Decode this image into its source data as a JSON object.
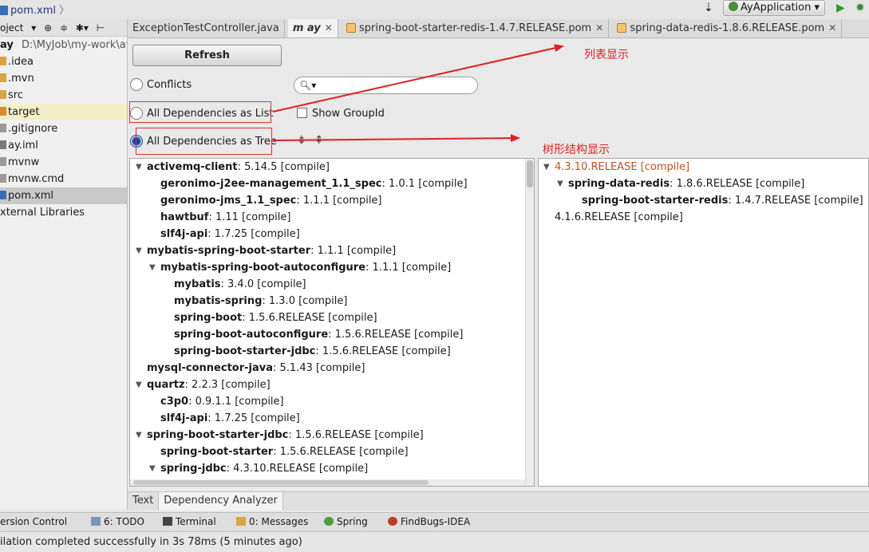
{
  "topbar": {
    "breadcrumb": "pom.xml",
    "run_config": "AyApplication"
  },
  "project": {
    "toolbar_label": "oject",
    "root_label": "ay",
    "root_path": "D:\\MyJob\\my-work\\ay",
    "items": [
      {
        "label": ".idea"
      },
      {
        "label": ".mvn"
      },
      {
        "label": "src"
      },
      {
        "label": "target"
      },
      {
        "label": ".gitignore"
      },
      {
        "label": "ay.iml"
      },
      {
        "label": "mvnw"
      },
      {
        "label": "mvnw.cmd"
      },
      {
        "label": "pom.xml"
      },
      {
        "label": "xternal Libraries"
      }
    ]
  },
  "tabs": [
    {
      "label": "ExceptionTestController.java"
    },
    {
      "label": "m ay"
    },
    {
      "label": "spring-boot-starter-redis-1.4.7.RELEASE.pom"
    },
    {
      "label": "spring-data-redis-1.8.6.RELEASE.pom"
    }
  ],
  "analyzer": {
    "refresh_label": "Refresh",
    "conflicts_label": "Conflicts",
    "as_list_label": "All Dependencies as List",
    "as_tree_label": "All Dependencies as Tree",
    "show_groupid_label": "Show GroupId",
    "search_placeholder": "",
    "selected_mode": "tree"
  },
  "left_tree": [
    {
      "name": "activemq-client",
      "version": ": 5.14.5 [compile]",
      "indent": 0,
      "expanded": true
    },
    {
      "name": "geronimo-j2ee-management_1.1_spec",
      "version": ": 1.0.1 [compile]",
      "indent": 1
    },
    {
      "name": "geronimo-jms_1.1_spec",
      "version": ": 1.1.1 [compile]",
      "indent": 1
    },
    {
      "name": "hawtbuf",
      "version": ": 1.11 [compile]",
      "indent": 1
    },
    {
      "name": "slf4j-api",
      "version": ": 1.7.25 [compile]",
      "indent": 1
    },
    {
      "name": "mybatis-spring-boot-starter",
      "version": ": 1.1.1 [compile]",
      "indent": 0,
      "expanded": true
    },
    {
      "name": "mybatis-spring-boot-autoconfigure",
      "version": ": 1.1.1 [compile]",
      "indent": 1,
      "expanded": true
    },
    {
      "name": "mybatis",
      "version": ": 3.4.0 [compile]",
      "indent": 2
    },
    {
      "name": "mybatis-spring",
      "version": ": 1.3.0 [compile]",
      "indent": 2
    },
    {
      "name": "spring-boot",
      "version": ": 1.5.6.RELEASE [compile]",
      "indent": 2
    },
    {
      "name": "spring-boot-autoconfigure",
      "version": ": 1.5.6.RELEASE [compile]",
      "indent": 2
    },
    {
      "name": "spring-boot-starter-jdbc",
      "version": ": 1.5.6.RELEASE [compile]",
      "indent": 2
    },
    {
      "name": "mysql-connector-java",
      "version": ": 5.1.43 [compile]",
      "indent": 0
    },
    {
      "name": "quartz",
      "version": ": 2.2.3 [compile]",
      "indent": 0,
      "expanded": true
    },
    {
      "name": "c3p0",
      "version": ": 0.9.1.1 [compile]",
      "indent": 1
    },
    {
      "name": "slf4j-api",
      "version": ": 1.7.25 [compile]",
      "indent": 1
    },
    {
      "name": "spring-boot-starter-jdbc",
      "version": ": 1.5.6.RELEASE [compile]",
      "indent": 0,
      "expanded": true
    },
    {
      "name": "spring-boot-starter",
      "version": ": 1.5.6.RELEASE [compile]",
      "indent": 1
    },
    {
      "name": "spring-jdbc",
      "version": ": 4.3.10.RELEASE [compile]",
      "indent": 1,
      "expanded": true
    }
  ],
  "right_tree": [
    {
      "name": "",
      "version": "4.3.10.RELEASE [compile]",
      "indent": 0,
      "expanded": true,
      "orange": true
    },
    {
      "name": "spring-data-redis",
      "version": ": 1.8.6.RELEASE [compile]",
      "indent": 1,
      "expanded": true
    },
    {
      "name": "spring-boot-starter-redis",
      "version": ": 1.4.7.RELEASE [compile]",
      "indent": 2
    },
    {
      "name": "",
      "version": "4.1.6.RELEASE [compile]",
      "indent": 0
    }
  ],
  "bottom_tabs": [
    {
      "label": "Text"
    },
    {
      "label": "Dependency Analyzer"
    }
  ],
  "tool_windows": [
    {
      "label": "ersion Control"
    },
    {
      "label": "6: TODO"
    },
    {
      "label": "Terminal"
    },
    {
      "label": "0: Messages"
    },
    {
      "label": "Spring"
    },
    {
      "label": "FindBugs-IDEA"
    }
  ],
  "status": "ilation completed successfully in 3s 78ms (5 minutes ago)",
  "annotations": {
    "list_note": "列表显示",
    "tree_note": "树形结构显示"
  },
  "colors": {
    "annotation": "#e02020",
    "conflict_version": "#cc4e1a",
    "selection": "#c9c9c9"
  }
}
